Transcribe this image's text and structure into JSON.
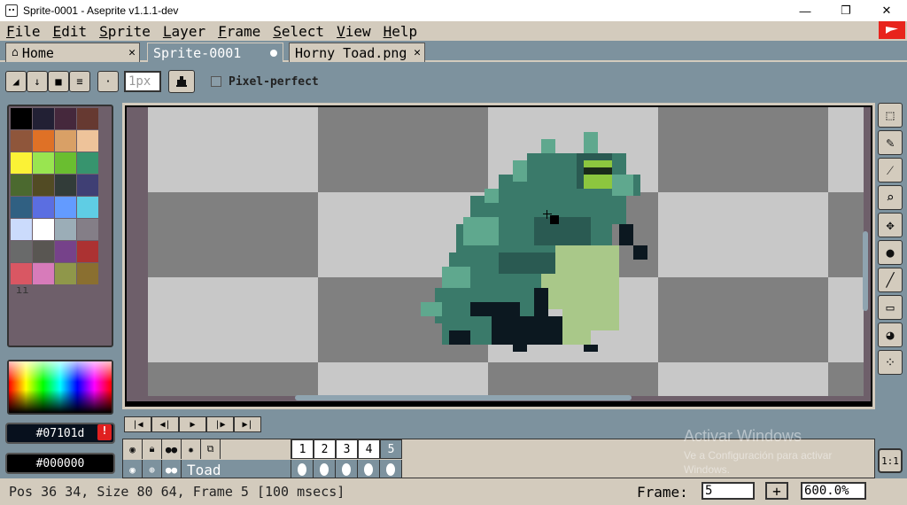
{
  "window": {
    "title": "Sprite-0001 - Aseprite v1.1.1-dev",
    "minimize": "—",
    "maximize": "❐",
    "close": "✕"
  },
  "menu": [
    "File",
    "Edit",
    "Sprite",
    "Layer",
    "Frame",
    "Select",
    "View",
    "Help"
  ],
  "tabs": [
    {
      "label": "Home",
      "close": "✕"
    },
    {
      "label": "Sprite-0001"
    },
    {
      "label": "Horny Toad.png",
      "close": "✕"
    }
  ],
  "toolbar": {
    "brush_size": "1px",
    "pixel_perfect_label": "Pixel-perfect",
    "pixel_perfect_checked": false
  },
  "palette": {
    "colors": [
      "#000000",
      "#222034",
      "#45283c",
      "#663931",
      "#8f563b",
      "#df7126",
      "#d9a066",
      "#eec39a",
      "#fbf236",
      "#99e550",
      "#6abe30",
      "#37946e",
      "#4b692f",
      "#524b24",
      "#323c39",
      "#3f3f74",
      "#306082",
      "#5b6ee1",
      "#639bff",
      "#5fcde4",
      "#cbdbfc",
      "#ffffff",
      "#9badb7",
      "#847e87",
      "#696a6a",
      "#595652",
      "#76428a",
      "#ac3232",
      "#d95763",
      "#d77bba",
      "#8f974a",
      "#8a6f30"
    ]
  },
  "colors": {
    "foreground": "#07101d",
    "background": "#000000",
    "warning": "!"
  },
  "tools": [
    "marquee-icon",
    "pencil-icon",
    "eyedropper-icon",
    "zoom-icon",
    "move-icon",
    "fill-icon",
    "line-icon",
    "rectangle-icon",
    "blur-icon",
    "spray-icon"
  ],
  "timeline": {
    "frames": [
      "1",
      "2",
      "3",
      "4",
      "5"
    ],
    "current_frame_index": 4,
    "layers": [
      {
        "name": "Toad"
      }
    ]
  },
  "one_to_one": "1:1",
  "watermark": {
    "line1": "Activar Windows",
    "line2": "Ve a Configuración para activar",
    "line3": "Windows."
  },
  "status": {
    "text": "Pos 36 34, Size 80 64, Frame 5 [100 msecs]",
    "frame_label": "Frame:",
    "frame_value": "5",
    "plus": "+",
    "zoom": "600.0%"
  }
}
